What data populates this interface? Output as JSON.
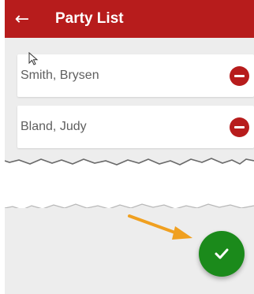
{
  "header": {
    "title": "Party List",
    "back_icon": "arrow-left-icon"
  },
  "parties": [
    {
      "name": "Smith, Brysen",
      "action_icon": "remove-circle-icon"
    },
    {
      "name": "Bland, Judy",
      "action_icon": "remove-circle-icon"
    }
  ],
  "fab": {
    "icon": "checkmark-icon",
    "color": "#1b8a1b"
  },
  "annotation": {
    "icon": "arrow-pointer-icon",
    "color": "#f0a020"
  },
  "colors": {
    "header": "#b71c1c",
    "remove": "#b71c1c",
    "background": "#ededed"
  }
}
